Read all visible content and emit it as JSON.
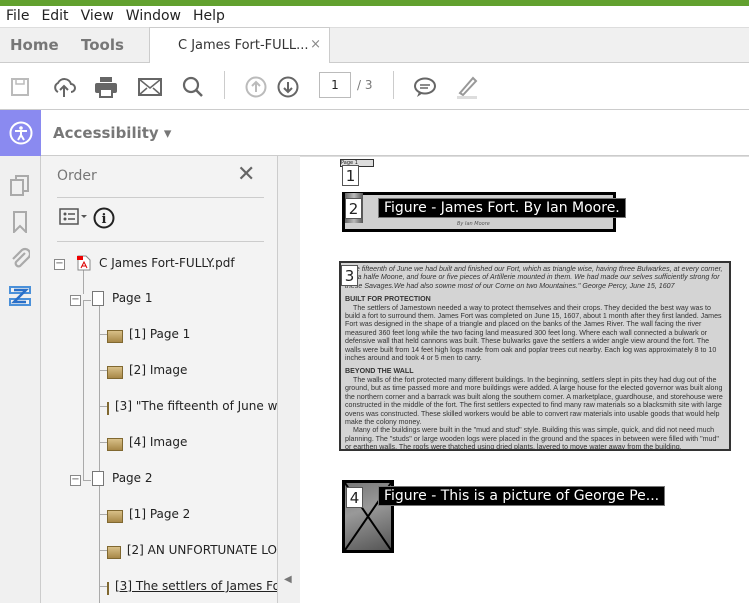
{
  "menu": [
    "File",
    "Edit",
    "View",
    "Window",
    "Help"
  ],
  "tabs": {
    "home": "Home",
    "tools": "Tools",
    "document": "C James Fort-FULL...",
    "close": "×"
  },
  "toolbar": {
    "page_current": "1",
    "page_total": "/ 3"
  },
  "accessibility": {
    "label": "Accessibility ▾"
  },
  "panel": {
    "title": "Order",
    "tree": {
      "root": "C James Fort-FULLY.pdf",
      "pages": [
        {
          "label": "Page 1",
          "items": [
            "[1]  Page 1",
            "[2]  Image",
            "[3]   \"The fifteenth of June w",
            "[4]  Image"
          ]
        },
        {
          "label": "Page 2",
          "items": [
            "[1]  Page 2",
            "[2]  AN UNFORTUNATE LO",
            "[3]  The settlers of James Fo"
          ]
        }
      ]
    }
  },
  "doc": {
    "page_label": "Page 1",
    "tags": [
      "1",
      "2",
      "3",
      "4"
    ],
    "figure2": "Figure - James Fort. By Ian Moore.",
    "figure2_caption": "By Ian Moore",
    "figure4": "Figure - This is a picture of George Pe...",
    "quote": "\"The fifteenth of June we had built and finished our Fort, which as triangle wise, having three Bulwarkes, at every corner, like a halfe Moone, and foure or five pieces of Artillerie mounted in them. We had made our selves sufficiently strong for these Savages.We had also sowne most of our Corne on two Mountaines.\" George Percy, June 15, 1607",
    "h1": "BUILT FOR PROTECTION",
    "p1": "The settlers of Jamestown needed a way to protect themselves and their crops. They decided the best way was to build a fort to surround them. James Fort was completed on June 15, 1607, about 1 month after they first landed. James Fort was designed in the shape of a triangle and placed on the banks of the James River. The wall facing the river measured 360 feet long while the two facing land measured 300 feet long. Where each wall connected a bulwark or defensive wall that held cannons was built. These bulwarks gave the settlers a wider angle view around the fort. The walls were built from 14 feet high logs made from oak and poplar trees cut nearby. Each log was approximately 8 to 10 inches around and took 4 or 5 men to carry.",
    "h2": "BEYOND THE WALL",
    "p2": "The walls of the fort protected many different buildings. In the beginning, settlers slept in pits they had dug out of the ground, but as time passed more and more buildings were added. A large house for the elected governor was built along the northern corner and a barrack was built along the southern corner. A marketplace, guardhouse, and storehouse were constructed in the middle of the fort. The first settlers expected to find many raw materials so a blacksmith site with large ovens was constructed. These skilled workers would be able to convert raw materials into usable goods that would help make the colony money.",
    "p3": "Many of the buildings were built in the \"mud and stud\" style. Building this was simple, quick, and did not need much planning. The \"studs\" or large wooden logs were placed in the ground and the spaces in between were filled with \"mud\" or earthen walls. The roofs were thatched using dried plants, layered to move water away from the building."
  }
}
